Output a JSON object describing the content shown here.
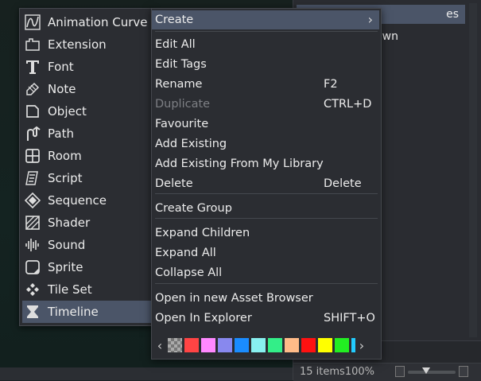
{
  "asset_browser": {
    "rows": [
      "es",
      "spawn"
    ],
    "status": {
      "count": "15 items100%"
    }
  },
  "create_submenu": {
    "items": [
      {
        "label": "Animation Curve",
        "icon": "animation-curve-icon"
      },
      {
        "label": "Extension",
        "icon": "extension-icon"
      },
      {
        "label": "Font",
        "icon": "font-icon"
      },
      {
        "label": "Note",
        "icon": "note-icon"
      },
      {
        "label": "Object",
        "icon": "object-icon"
      },
      {
        "label": "Path",
        "icon": "path-icon"
      },
      {
        "label": "Room",
        "icon": "room-icon"
      },
      {
        "label": "Script",
        "icon": "script-icon"
      },
      {
        "label": "Sequence",
        "icon": "sequence-icon"
      },
      {
        "label": "Shader",
        "icon": "shader-icon"
      },
      {
        "label": "Sound",
        "icon": "sound-icon"
      },
      {
        "label": "Sprite",
        "icon": "sprite-icon"
      },
      {
        "label": "Tile Set",
        "icon": "tile-set-icon"
      },
      {
        "label": "Timeline",
        "icon": "timeline-icon"
      }
    ],
    "highlighted": "Timeline"
  },
  "context_menu": {
    "create": "Create",
    "items": [
      {
        "label": "Edit All",
        "shortcut": ""
      },
      {
        "label": "Edit Tags",
        "shortcut": ""
      },
      {
        "label": "Rename",
        "shortcut": "F2"
      },
      {
        "label": "Duplicate",
        "shortcut": "CTRL+D",
        "disabled": true
      },
      {
        "label": "Favourite",
        "shortcut": ""
      },
      {
        "label": "Add Existing",
        "shortcut": ""
      },
      {
        "label": "Add Existing From My Library",
        "shortcut": ""
      },
      {
        "label": "Delete",
        "shortcut": "Delete"
      },
      {
        "label": "Create Group",
        "shortcut": ""
      },
      {
        "label": "Expand Children",
        "shortcut": ""
      },
      {
        "label": "Expand All",
        "shortcut": ""
      },
      {
        "label": "Collapse All",
        "shortcut": ""
      },
      {
        "label": "Open in new Asset Browser",
        "shortcut": ""
      },
      {
        "label": "Open In Explorer",
        "shortcut": "SHIFT+O"
      }
    ],
    "colors": [
      "none",
      "#ff4444",
      "#ff88ff",
      "#8888ee",
      "#1a8cff",
      "#88f0f0",
      "#33ee88",
      "#ffbb88",
      "#ff1111",
      "#ffff00",
      "#22ee22",
      "#22ccff"
    ]
  }
}
